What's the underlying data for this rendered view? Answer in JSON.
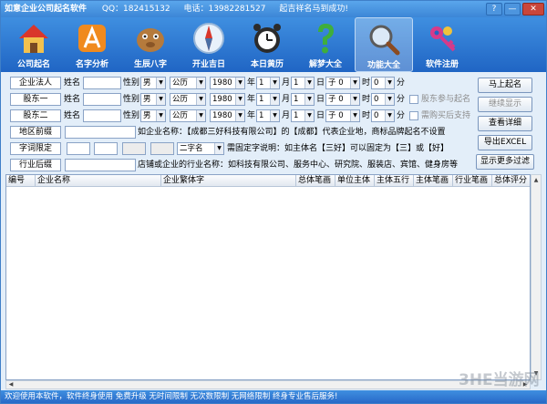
{
  "title": {
    "app": "如意企业公司起名软件",
    "qq": "QQ：182415132",
    "phone": "电话：13982281527",
    "slogan": "起吉祥名马到成功!"
  },
  "window_controls": [
    "?",
    "—",
    "✕"
  ],
  "toolbar": [
    {
      "label": "公司起名",
      "icon": "house-icon"
    },
    {
      "label": "名字分析",
      "icon": "analysis-icon"
    },
    {
      "label": "生辰八字",
      "icon": "zodiac-icon"
    },
    {
      "label": "开业吉日",
      "icon": "compass-icon"
    },
    {
      "label": "本日黄历",
      "icon": "alarm-clock-icon"
    },
    {
      "label": "解梦大全",
      "icon": "question-icon"
    },
    {
      "label": "功能大全",
      "icon": "magnifier-icon",
      "active": true
    },
    {
      "label": "软件注册",
      "icon": "keys-icon"
    }
  ],
  "form": {
    "persons": [
      {
        "role": "企业法人",
        "name_label": "姓名",
        "gender_label": "性别",
        "gender": "男",
        "calendar": "公历",
        "year": "1980",
        "month": "1",
        "day": "1",
        "hour": "子 0"
      },
      {
        "role": "股东一",
        "name_label": "姓名",
        "gender_label": "性别",
        "gender": "男",
        "calendar": "公历",
        "year": "1980",
        "month": "1",
        "day": "1",
        "hour": "子 0"
      },
      {
        "role": "股东二",
        "name_label": "姓名",
        "gender_label": "性别",
        "gender": "男",
        "calendar": "公历",
        "year": "1980",
        "month": "1",
        "day": "1",
        "hour": "子 0"
      }
    ],
    "unit_year": "年",
    "unit_month": "月",
    "unit_day": "日",
    "unit_hour": "时",
    "minute": "0",
    "unit_minute": "分",
    "check_shareholder": "股东参与起名",
    "check_support": "需购买后支持",
    "region_label": "地区前缀",
    "region_hint": "如企业名称：【成都三好科技有限公司】的【成都】代表企业地，商标品牌起名不设置",
    "char_limit_label": "字词限定",
    "char_count": "二字名",
    "char_hint": "需固定字说明：如主体名【三好】可以固定为【三】或【好】",
    "industry_label": "行业后缀",
    "industry_hint": "店铺或企业的行业名称：如科技有限公司、服务中心、研究院、服装店、宾馆、健身房等"
  },
  "buttons": {
    "start": "马上起名",
    "continue": "继续显示",
    "detail": "查看详细",
    "export": "导出EXCEL",
    "filter": "显示更多过滤"
  },
  "table": {
    "columns": [
      "编号",
      "企业名称",
      "企业繁体字",
      "总体笔画",
      "单位主体",
      "主体五行",
      "主体笔画",
      "行业笔画",
      "总体评分"
    ]
  },
  "status": "欢迎使用本软件，软件终身使用  免费升级  无时间限制  无次数限制  无网络限制  终身专业售后服务!",
  "watermark": "3HE当游网",
  "colors": {
    "titlebar": "#3c86d6",
    "toolbar": "#2065c4",
    "panel": "#e3eef9"
  }
}
